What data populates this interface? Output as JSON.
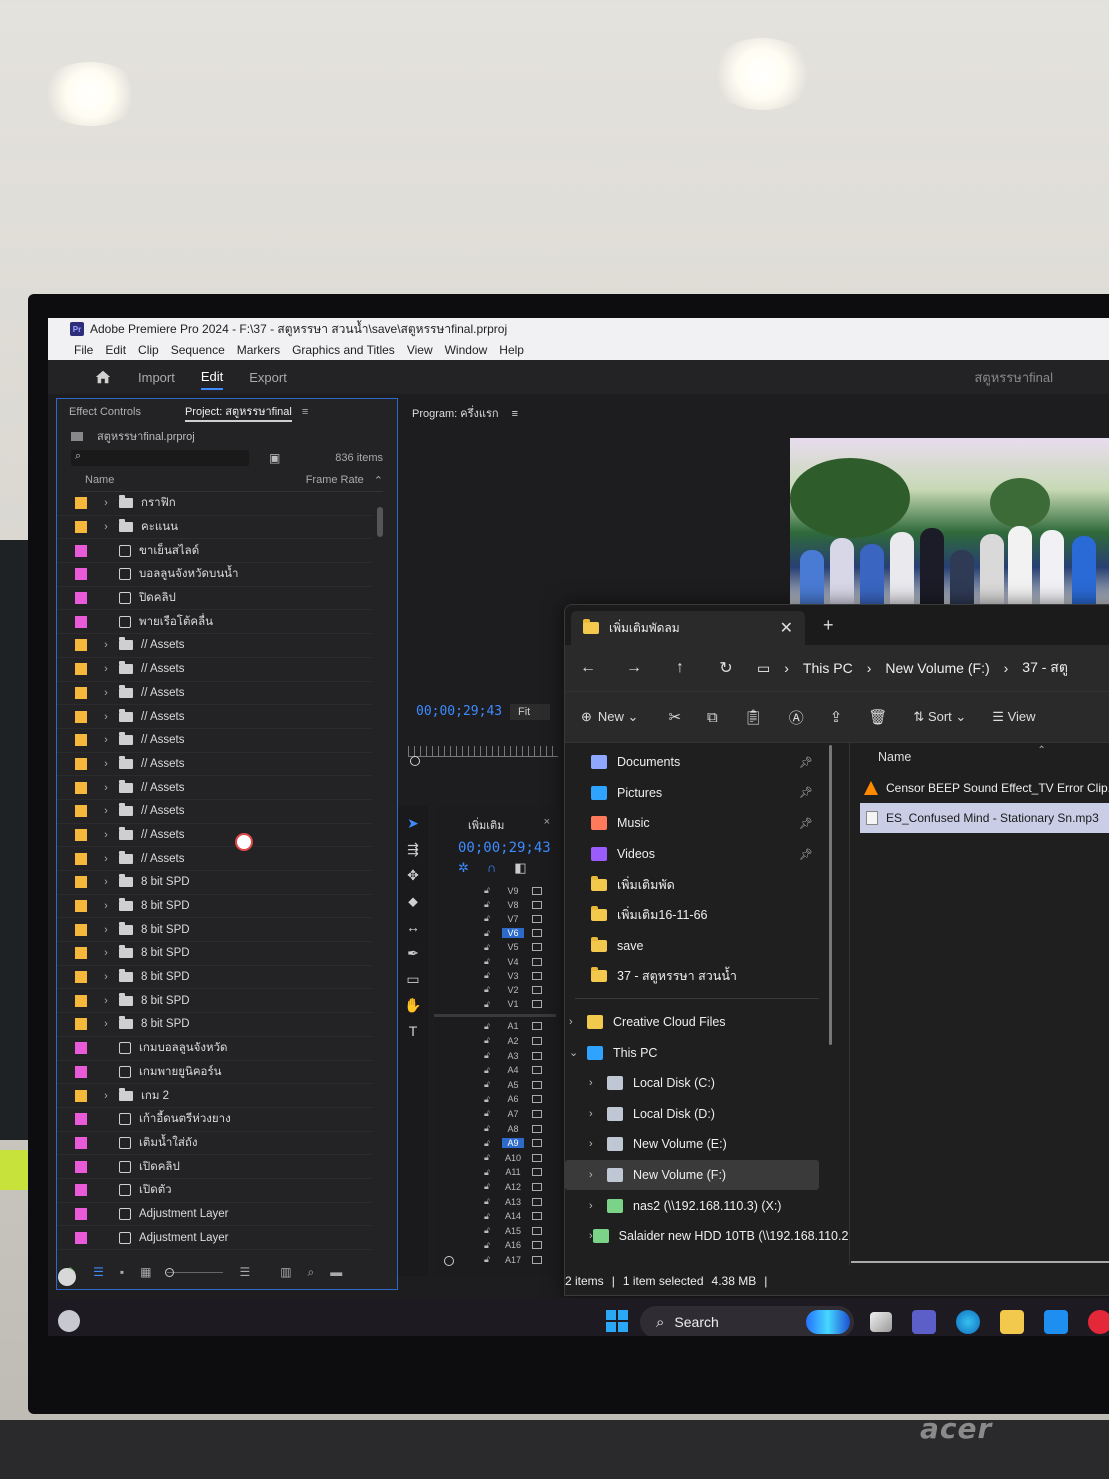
{
  "premiere": {
    "app_title": "Adobe Premiere Pro 2024 - F:\\37 - สตูหรรษา สวนน้ำ\\save\\สตูหรรษาfinal.prproj",
    "menu": [
      "File",
      "Edit",
      "Clip",
      "Sequence",
      "Markers",
      "Graphics and Titles",
      "View",
      "Window",
      "Help"
    ],
    "workspace_tabs": {
      "import": "Import",
      "edit": "Edit",
      "export": "Export"
    },
    "project_name": "สตูหรรษาfinal",
    "panel_tabs": {
      "effect_controls": "Effect Controls",
      "project": "Project: สตูหรรษาfinal"
    },
    "project_file": "สตูหรรษาfinal.prproj",
    "items_count": "836 items",
    "columns": {
      "name": "Name",
      "frame_rate": "Frame Rate"
    },
    "rows": [
      {
        "label": "กราฟิก",
        "type": "folder",
        "color": "#f5b83a"
      },
      {
        "label": "คะแนน",
        "type": "folder",
        "color": "#f5b83a"
      },
      {
        "label": "ขาเย็นสไลด์",
        "type": "sequence",
        "color": "#e85ad8"
      },
      {
        "label": "บอลลูนจังหวัดบนน้ำ",
        "type": "sequence",
        "color": "#e85ad8"
      },
      {
        "label": "ปิดคลิป",
        "type": "sequence",
        "color": "#e85ad8"
      },
      {
        "label": "พายเรือโต้คลื่น",
        "type": "sequence",
        "color": "#e85ad8"
      },
      {
        "label": "// Assets",
        "type": "folder",
        "color": "#f5b83a"
      },
      {
        "label": "// Assets",
        "type": "folder",
        "color": "#f5b83a"
      },
      {
        "label": "// Assets",
        "type": "folder",
        "color": "#f5b83a"
      },
      {
        "label": "// Assets",
        "type": "folder",
        "color": "#f5b83a"
      },
      {
        "label": "// Assets",
        "type": "folder",
        "color": "#f5b83a"
      },
      {
        "label": "// Assets",
        "type": "folder",
        "color": "#f5b83a"
      },
      {
        "label": "// Assets",
        "type": "folder",
        "color": "#f5b83a"
      },
      {
        "label": "// Assets",
        "type": "folder",
        "color": "#f5b83a"
      },
      {
        "label": "// Assets",
        "type": "folder",
        "color": "#f5b83a"
      },
      {
        "label": "// Assets",
        "type": "folder",
        "color": "#f5b83a"
      },
      {
        "label": "8 bit SPD",
        "type": "folder",
        "color": "#f5b83a"
      },
      {
        "label": "8 bit SPD",
        "type": "folder",
        "color": "#f5b83a"
      },
      {
        "label": "8 bit SPD",
        "type": "folder",
        "color": "#f5b83a"
      },
      {
        "label": "8 bit SPD",
        "type": "folder",
        "color": "#f5b83a"
      },
      {
        "label": "8 bit SPD",
        "type": "folder",
        "color": "#f5b83a"
      },
      {
        "label": "8 bit SPD",
        "type": "folder",
        "color": "#f5b83a"
      },
      {
        "label": "8 bit SPD",
        "type": "folder",
        "color": "#f5b83a"
      },
      {
        "label": "เกมบอลลูนจังหวัด",
        "type": "sequence",
        "color": "#e85ad8"
      },
      {
        "label": "เกมพายยูนิคอร์น",
        "type": "sequence",
        "color": "#e85ad8"
      },
      {
        "label": "เกม 2",
        "type": "folder",
        "color": "#f5b83a"
      },
      {
        "label": "เก้าอี้ดนตรีห่วงยาง",
        "type": "sequence",
        "color": "#e85ad8"
      },
      {
        "label": "เติมน้ำใส่ถัง",
        "type": "sequence",
        "color": "#e85ad8"
      },
      {
        "label": "เปิดคลิป",
        "type": "sequence",
        "color": "#e85ad8"
      },
      {
        "label": "เปิดตัว",
        "type": "sequence",
        "color": "#e85ad8"
      },
      {
        "label": "Adjustment Layer",
        "type": "sequence",
        "color": "#e85ad8"
      },
      {
        "label": "Adjustment Layer",
        "type": "sequence",
        "color": "#e85ad8"
      }
    ],
    "program_label": "Program: ครึ่งแรก",
    "program_timecode": "00;00;29;43",
    "fit_label": "Fit",
    "timeline_tab": "เพิ่มเติม",
    "timeline_timecode": "00;00;29;43",
    "video_tracks": [
      "V9",
      "V8",
      "V7",
      "V6",
      "V5",
      "V4",
      "V3",
      "V2",
      "V1"
    ],
    "audio_tracks": [
      "A1",
      "A2",
      "A3",
      "A4",
      "A5",
      "A6",
      "A7",
      "A8",
      "A9",
      "A10",
      "A11",
      "A12",
      "A13",
      "A14",
      "A15",
      "A16",
      "A17"
    ],
    "selected_video_track": "V6",
    "selected_audio_track": "A9"
  },
  "explorer": {
    "tab_title": "เพิ่มเติมพัดลม",
    "breadcrumb": [
      "This PC",
      "New Volume (F:)",
      "37 - สตู"
    ],
    "commands": {
      "new": "New",
      "sort": "Sort",
      "view": "View"
    },
    "quick_access": [
      {
        "label": "Documents",
        "icon": "documents-icon",
        "color": "#8ea8ff",
        "pinned": true
      },
      {
        "label": "Pictures",
        "icon": "pictures-icon",
        "color": "#2ea3ff",
        "pinned": true
      },
      {
        "label": "Music",
        "icon": "music-icon",
        "color": "#ff7a5a",
        "pinned": true
      },
      {
        "label": "Videos",
        "icon": "videos-icon",
        "color": "#9a5cff",
        "pinned": true
      },
      {
        "label": "เพิ่มเติมพัด",
        "icon": "folder-icon",
        "color": "#f2c94c",
        "pinned": false
      },
      {
        "label": "เพิ่มเติม16-11-66",
        "icon": "folder-icon",
        "color": "#f2c94c",
        "pinned": false
      },
      {
        "label": "save",
        "icon": "folder-icon",
        "color": "#f2c94c",
        "pinned": false
      },
      {
        "label": "37 - สตูหรรษา สวนน้ำ",
        "icon": "folder-icon",
        "color": "#f2c94c",
        "pinned": false
      }
    ],
    "tree": [
      {
        "label": "Creative Cloud Files",
        "expanded": false,
        "indent": 0,
        "icon": "creative-cloud-icon",
        "color": "#f2c94c",
        "selected": false
      },
      {
        "label": "This PC",
        "expanded": true,
        "indent": 0,
        "icon": "computer-icon",
        "color": "#2ea3ff",
        "selected": false
      },
      {
        "label": "Local Disk (C:)",
        "expanded": false,
        "indent": 1,
        "icon": "drive-icon",
        "color": "#bfc6d4",
        "selected": false
      },
      {
        "label": "Local Disk (D:)",
        "expanded": false,
        "indent": 1,
        "icon": "drive-icon",
        "color": "#bfc6d4",
        "selected": false
      },
      {
        "label": "New Volume (E:)",
        "expanded": false,
        "indent": 1,
        "icon": "drive-icon",
        "color": "#bfc6d4",
        "selected": false
      },
      {
        "label": "New Volume (F:)",
        "expanded": false,
        "indent": 1,
        "icon": "drive-icon",
        "color": "#bfc6d4",
        "selected": true
      },
      {
        "label": "nas2 (\\\\192.168.110.3) (X:)",
        "expanded": false,
        "indent": 1,
        "icon": "network-drive-icon",
        "color": "#7bd389",
        "selected": false
      },
      {
        "label": "Salaider new HDD 10TB (\\\\192.168.110.2",
        "expanded": false,
        "indent": 1,
        "icon": "network-drive-icon",
        "color": "#7bd389",
        "selected": false
      }
    ],
    "files_header": "Name",
    "files": [
      {
        "name": "Censor BEEP Sound Effect_TV Error Clip.m",
        "icon": "vlc-icon",
        "selected": false
      },
      {
        "name": "ES_Confused Mind - Stationary Sn.mp3",
        "icon": "audio-file-icon",
        "selected": true
      }
    ],
    "status": {
      "items": "2 items",
      "selected": "1 item selected",
      "size": "4.38 MB"
    }
  },
  "taskbar": {
    "search_label": "Search"
  },
  "monitor_brand": "acer"
}
